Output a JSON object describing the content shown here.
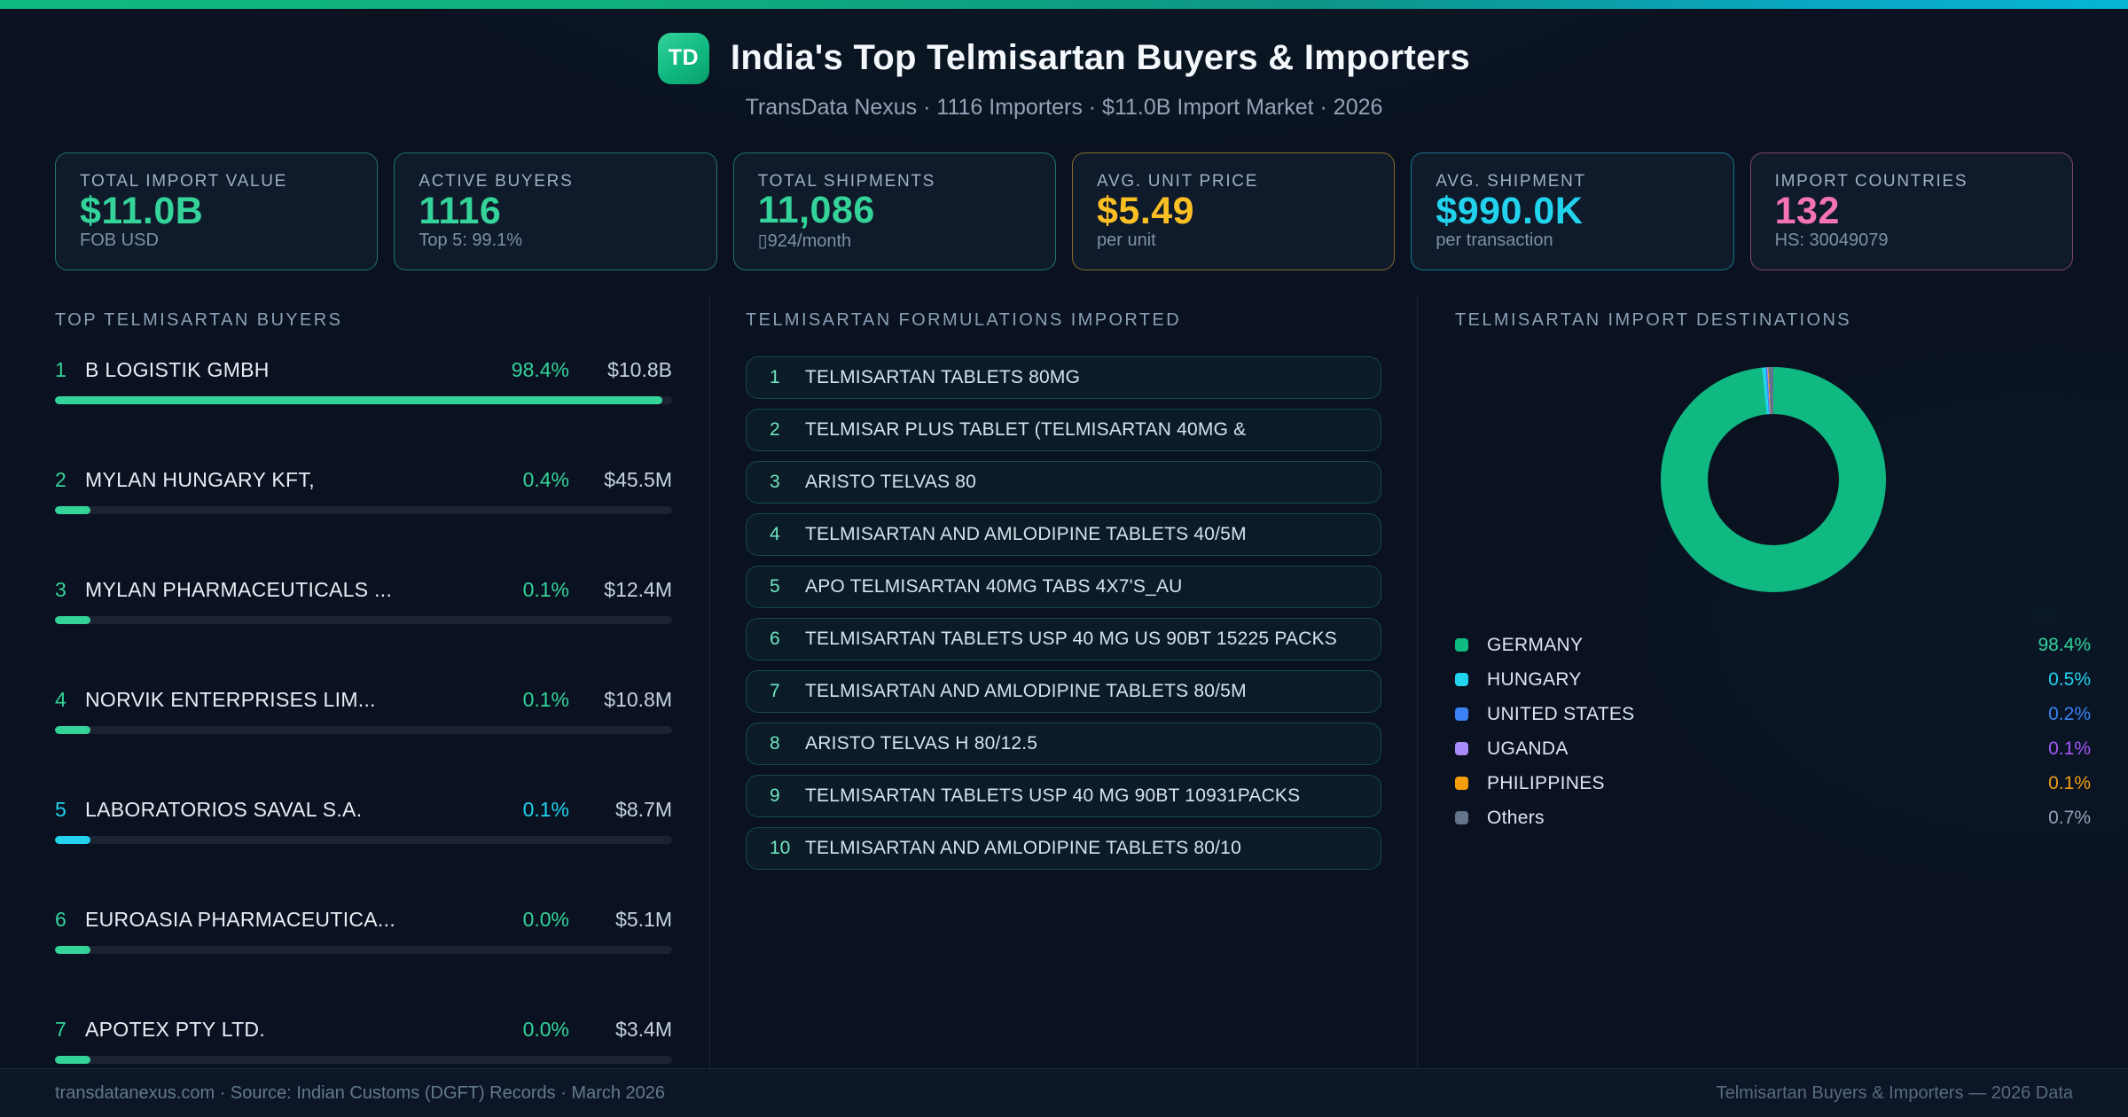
{
  "header": {
    "badge": "TD",
    "title": "India's Top Telmisartan Buyers & Importers",
    "subtitle": "TransData Nexus · 1116 Importers · $11.0B Import Market · 2026"
  },
  "stats": [
    {
      "label": "TOTAL IMPORT VALUE",
      "value": "$11.0B",
      "sub": "FOB USD",
      "accent": "#34d399"
    },
    {
      "label": "ACTIVE BUYERS",
      "value": "1116",
      "sub": "Top 5: 99.1%",
      "accent": "#34d399"
    },
    {
      "label": "TOTAL SHIPMENTS",
      "value": "11,086",
      "sub": "▯924/month",
      "accent": "#34d399"
    },
    {
      "label": "AVG. UNIT PRICE",
      "value": "$5.49",
      "sub": "per unit",
      "accent": "#fbbf24"
    },
    {
      "label": "AVG. SHIPMENT",
      "value": "$990.0K",
      "sub": "per transaction",
      "accent": "#22d3ee"
    },
    {
      "label": "IMPORT COUNTRIES",
      "value": "132",
      "sub": "HS: 30049079",
      "accent": "#f472b6"
    }
  ],
  "buyers": {
    "title": "TOP TELMISARTAN BUYERS",
    "rows": [
      {
        "rank": "1",
        "name": "B LOGISTIK GMBH",
        "pct": "98.4%",
        "value": "$10.8B",
        "accent": "#34d399",
        "fill": 98.4
      },
      {
        "rank": "2",
        "name": "MYLAN HUNGARY KFT,",
        "pct": "0.4%",
        "value": "$45.5M",
        "accent": "#34d399",
        "fill": 5.8
      },
      {
        "rank": "3",
        "name": "MYLAN PHARMACEUTICALS ...",
        "pct": "0.1%",
        "value": "$12.4M",
        "accent": "#34d399",
        "fill": 5.8
      },
      {
        "rank": "4",
        "name": "NORVIK ENTERPRISES LIM...",
        "pct": "0.1%",
        "value": "$10.8M",
        "accent": "#34d399",
        "fill": 5.8
      },
      {
        "rank": "5",
        "name": "LABORATORIOS SAVAL S.A.",
        "pct": "0.1%",
        "value": "$8.7M",
        "accent": "#22d3ee",
        "fill": 5.8
      },
      {
        "rank": "6",
        "name": "EUROASIA PHARMACEUTICA...",
        "pct": "0.0%",
        "value": "$5.1M",
        "accent": "#34d399",
        "fill": 5.8
      },
      {
        "rank": "7",
        "name": "APOTEX PTY LTD.",
        "pct": "0.0%",
        "value": "$3.4M",
        "accent": "#34d399",
        "fill": 5.8
      }
    ]
  },
  "formulations": {
    "title": "TELMISARTAN FORMULATIONS IMPORTED",
    "items": [
      "TELMISARTAN TABLETS 80MG",
      "TELMISAR PLUS TABLET (TELMISARTAN 40MG &",
      "ARISTO TELVAS 80",
      "TELMISARTAN AND AMLODIPINE TABLETS 40/5M",
      "APO TELMISARTAN 40MG TABS 4X7'S_AU",
      "TELMISARTAN TABLETS USP 40 MG US 90BT 15225 PACKS",
      "TELMISARTAN AND AMLODIPINE TABLETS 80/5M",
      "ARISTO TELVAS H 80/12.5",
      "TELMISARTAN TABLETS USP 40 MG 90BT 10931PACKS",
      "TELMISARTAN AND AMLODIPINE TABLETS 80/10"
    ]
  },
  "destinations": {
    "title": "TELMISARTAN IMPORT DESTINATIONS",
    "legend": [
      {
        "label": "GERMANY",
        "pct": "98.4%",
        "value": 98.4,
        "color": "#10b981",
        "text": "#34d399"
      },
      {
        "label": "HUNGARY",
        "pct": "0.5%",
        "value": 0.5,
        "color": "#22d3ee",
        "text": "#22d3ee"
      },
      {
        "label": "UNITED STATES",
        "pct": "0.2%",
        "value": 0.2,
        "color": "#3b82f6",
        "text": "#3b82f6"
      },
      {
        "label": "UGANDA",
        "pct": "0.1%",
        "value": 0.1,
        "color": "#a78bfa",
        "text": "#a855f7"
      },
      {
        "label": "PHILIPPINES",
        "pct": "0.1%",
        "value": 0.1,
        "color": "#f59e0b",
        "text": "#f59e0b"
      },
      {
        "label": "Others",
        "pct": "0.7%",
        "value": 0.7,
        "color": "#64748b",
        "text": "#94a3b8"
      }
    ]
  },
  "chart_data": {
    "type": "pie",
    "title": "TELMISARTAN IMPORT DESTINATIONS",
    "labels": [
      "GERMANY",
      "HUNGARY",
      "UNITED STATES",
      "UGANDA",
      "PHILIPPINES",
      "Others"
    ],
    "values": [
      98.4,
      0.5,
      0.2,
      0.1,
      0.1,
      0.7
    ],
    "colors": [
      "#10b981",
      "#22d3ee",
      "#3b82f6",
      "#a78bfa",
      "#f59e0b",
      "#64748b"
    ],
    "donut": true,
    "legend_position": "bottom"
  },
  "footer": {
    "left": "transdatanexus.com · Source: Indian Customs (DGFT) Records · March 2026",
    "right": "Telmisartan Buyers & Importers — 2026 Data"
  }
}
